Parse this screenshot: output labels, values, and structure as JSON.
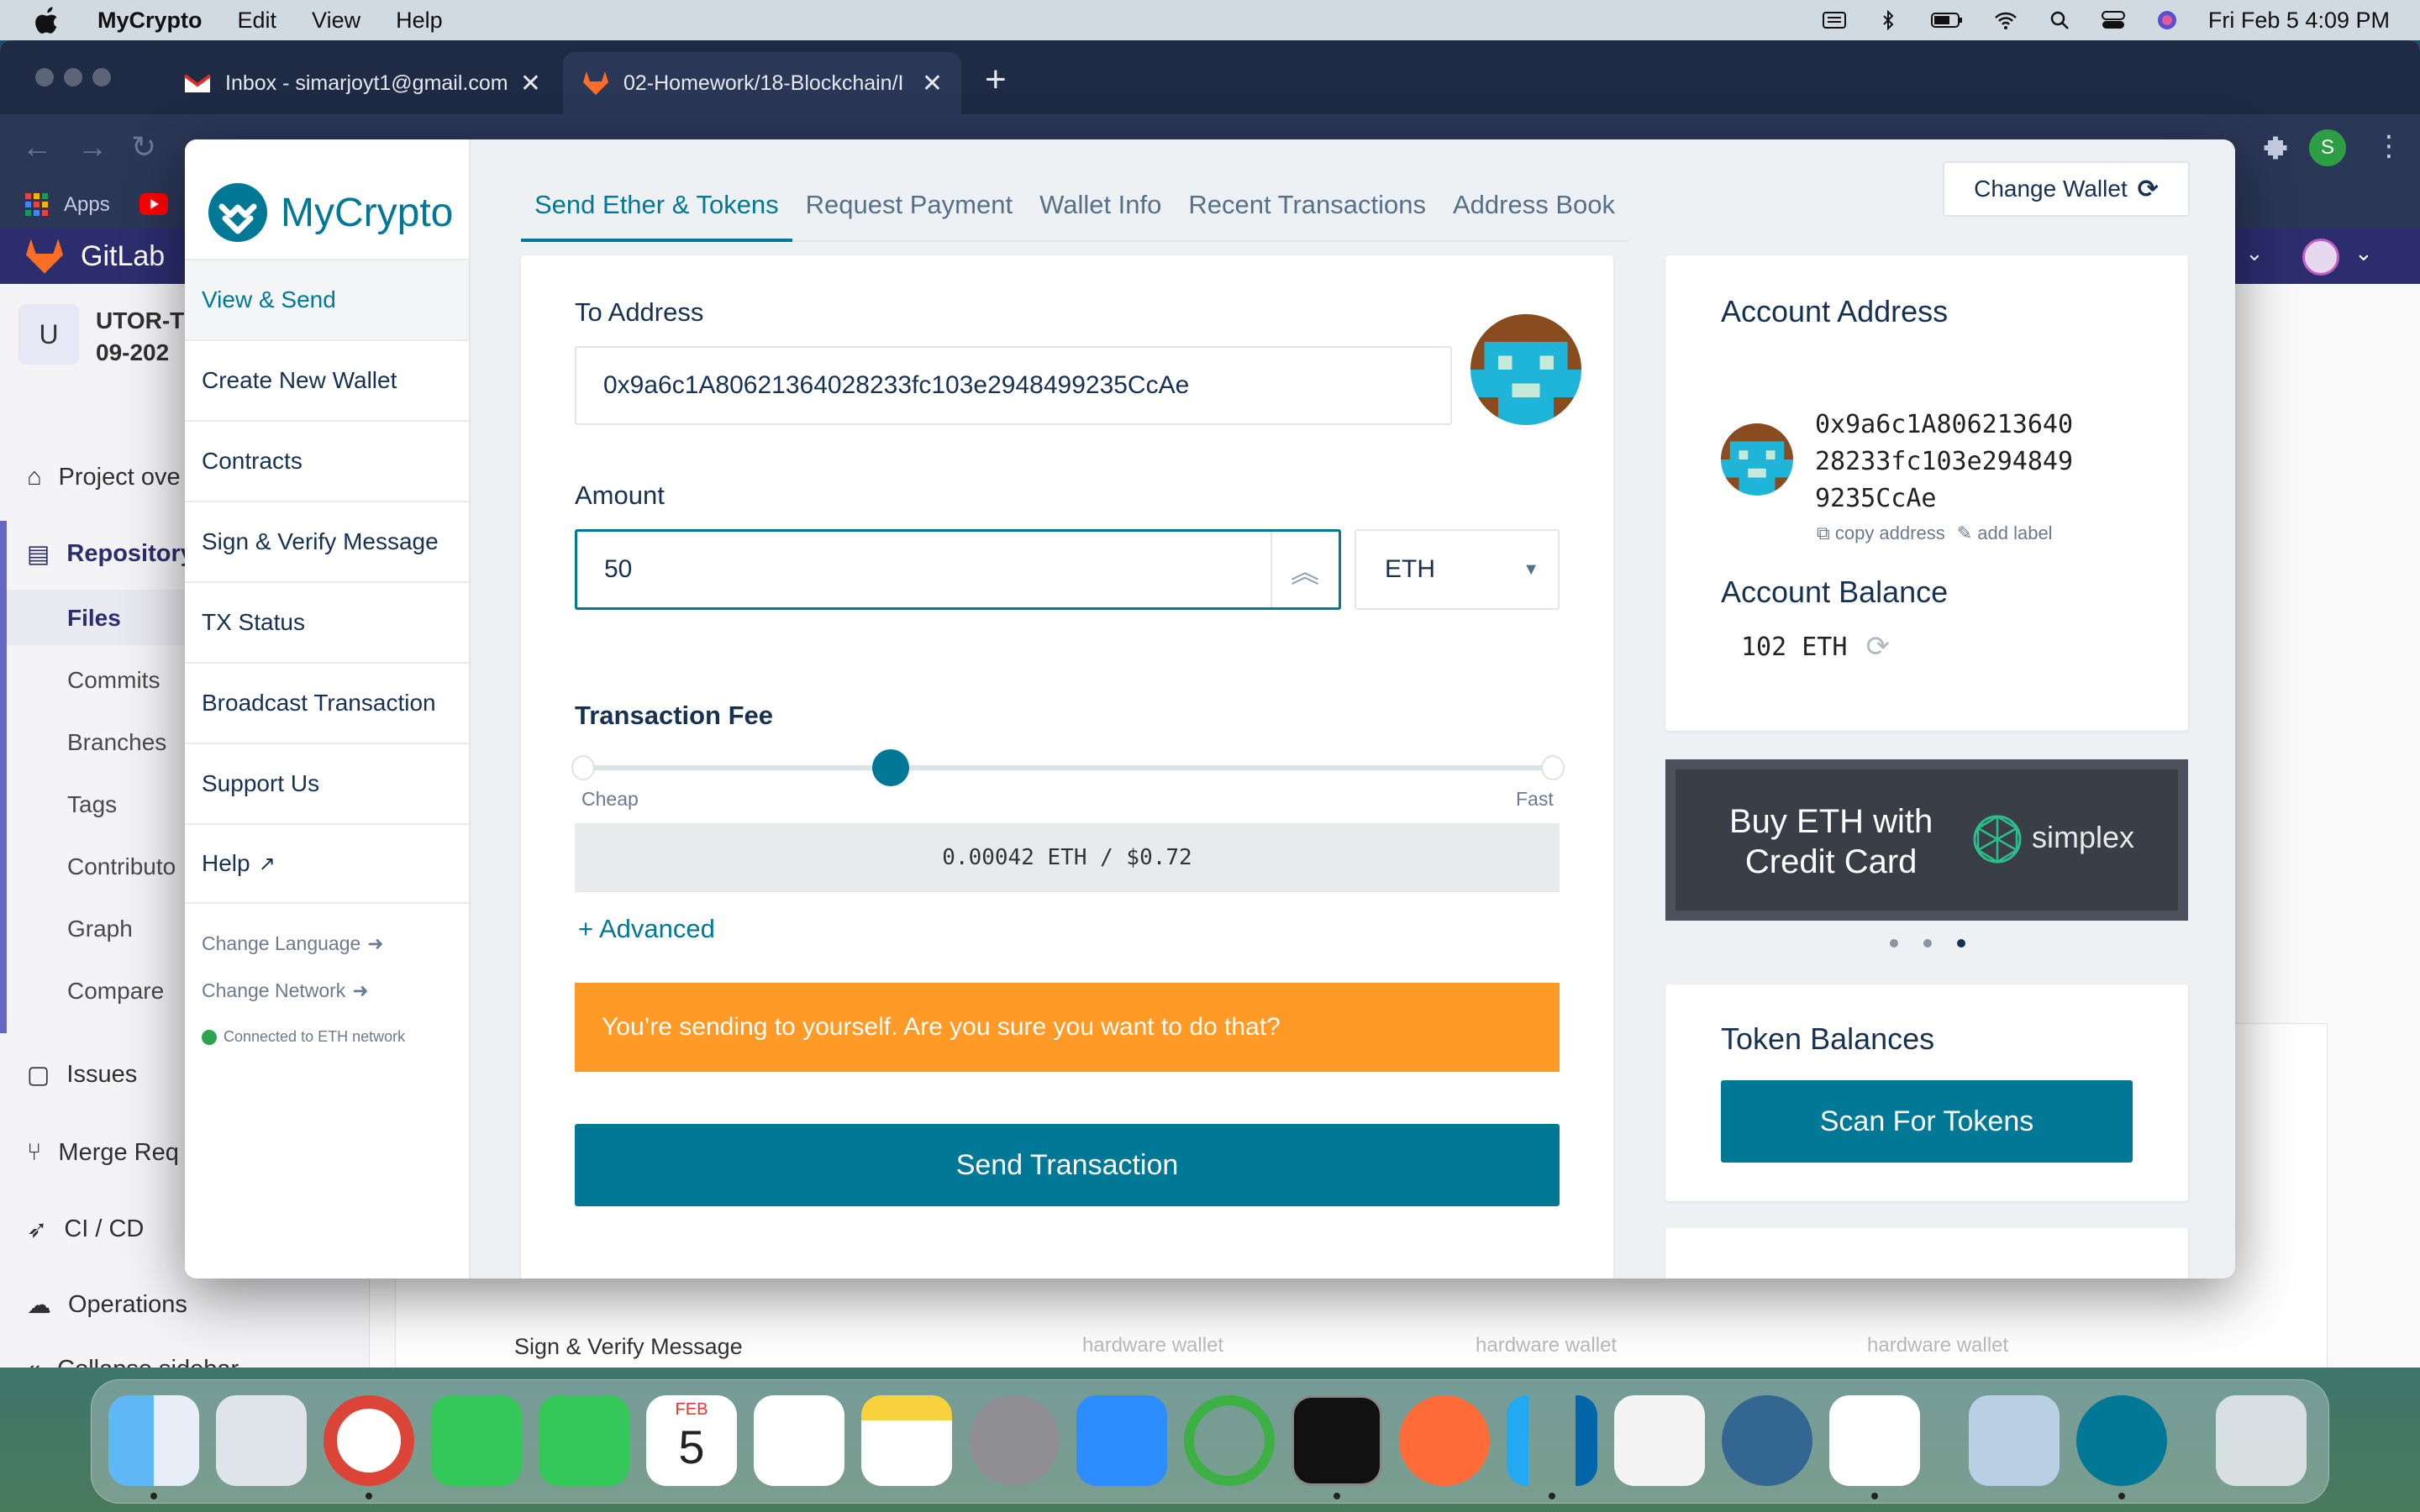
{
  "menubar": {
    "app_name": "MyCrypto",
    "menus": [
      "Edit",
      "View",
      "Help"
    ],
    "clock": "Fri Feb 5  4:09 PM"
  },
  "browser": {
    "tabs": [
      {
        "title": "Inbox - simarjoyt1@gmail.com"
      },
      {
        "title": "02-Homework/18-Blockchain/I"
      }
    ],
    "new_tab": "+",
    "bookmarks_apps": "Apps",
    "profile_initial": "S"
  },
  "gitlab": {
    "brand": "GitLab",
    "project_initial": "U",
    "project_name_1": "UTOR-T",
    "project_name_2": "09-202",
    "nav": {
      "project_overview": "Project ove",
      "repository": "Repository",
      "files": "Files",
      "commits": "Commits",
      "branches": "Branches",
      "tags": "Tags",
      "contributors": "Contributo",
      "graph": "Graph",
      "compare": "Compare",
      "issues": "Issues",
      "merge_requests": "Merge Req",
      "ci_cd": "CI / CD",
      "operations": "Operations",
      "collapse": "Collapse sidebar"
    },
    "background_card_label": "Sign & Verify Message",
    "hardware_wallet": "hardware wallet"
  },
  "mycrypto": {
    "logo_part1": "My",
    "logo_part2": "Crypto",
    "sidenav": {
      "view_send": "View & Send",
      "create_wallet": "Create New Wallet",
      "contracts": "Contracts",
      "sign_verify": "Sign & Verify Message",
      "tx_status": "TX Status",
      "broadcast": "Broadcast Transaction",
      "support": "Support Us",
      "help": "Help",
      "change_language": "Change Language",
      "change_network": "Change Network",
      "connection_status": "Connected to ETH network"
    },
    "tabs": {
      "send": "Send Ether & Tokens",
      "request": "Request Payment",
      "wallet_info": "Wallet Info",
      "recent": "Recent Transactions",
      "address_book": "Address Book"
    },
    "change_wallet": "Change Wallet",
    "send_form": {
      "to_label": "To Address",
      "to_value": "0x9a6c1A80621364028233fc103e2948499235CcAe",
      "amount_label": "Amount",
      "amount_value": "50",
      "unit": "ETH",
      "fee_label": "Transaction Fee",
      "fee_level": 0.32,
      "slider_cheap": "Cheap",
      "slider_fast": "Fast",
      "fee_value": "0.00042 ETH / $0.72",
      "advanced": "+ Advanced",
      "warning": "You’re sending to yourself. Are you sure you want to do that?",
      "send_button": "Send Transaction"
    },
    "account": {
      "address_title": "Account Address",
      "address_line1": "0x9a6c1A806213640",
      "address_line2": "28233fc103e294849",
      "address_line3": "9235CcAe",
      "copy_address": "copy address",
      "add_label": "add label",
      "balance_title": "Account Balance",
      "balance_value": "102 ETH"
    },
    "ad": {
      "line1": "Buy ETH with",
      "line2": "Credit Card",
      "brand": "simplex"
    },
    "tokens": {
      "title": "Token Balances",
      "scan_button": "Scan For Tokens"
    },
    "colors": {
      "primary": "#007896",
      "warning": "#ff9a27",
      "navy": "#163151"
    }
  },
  "dock": {
    "calendar_month": "FEB",
    "calendar_day": "5"
  }
}
